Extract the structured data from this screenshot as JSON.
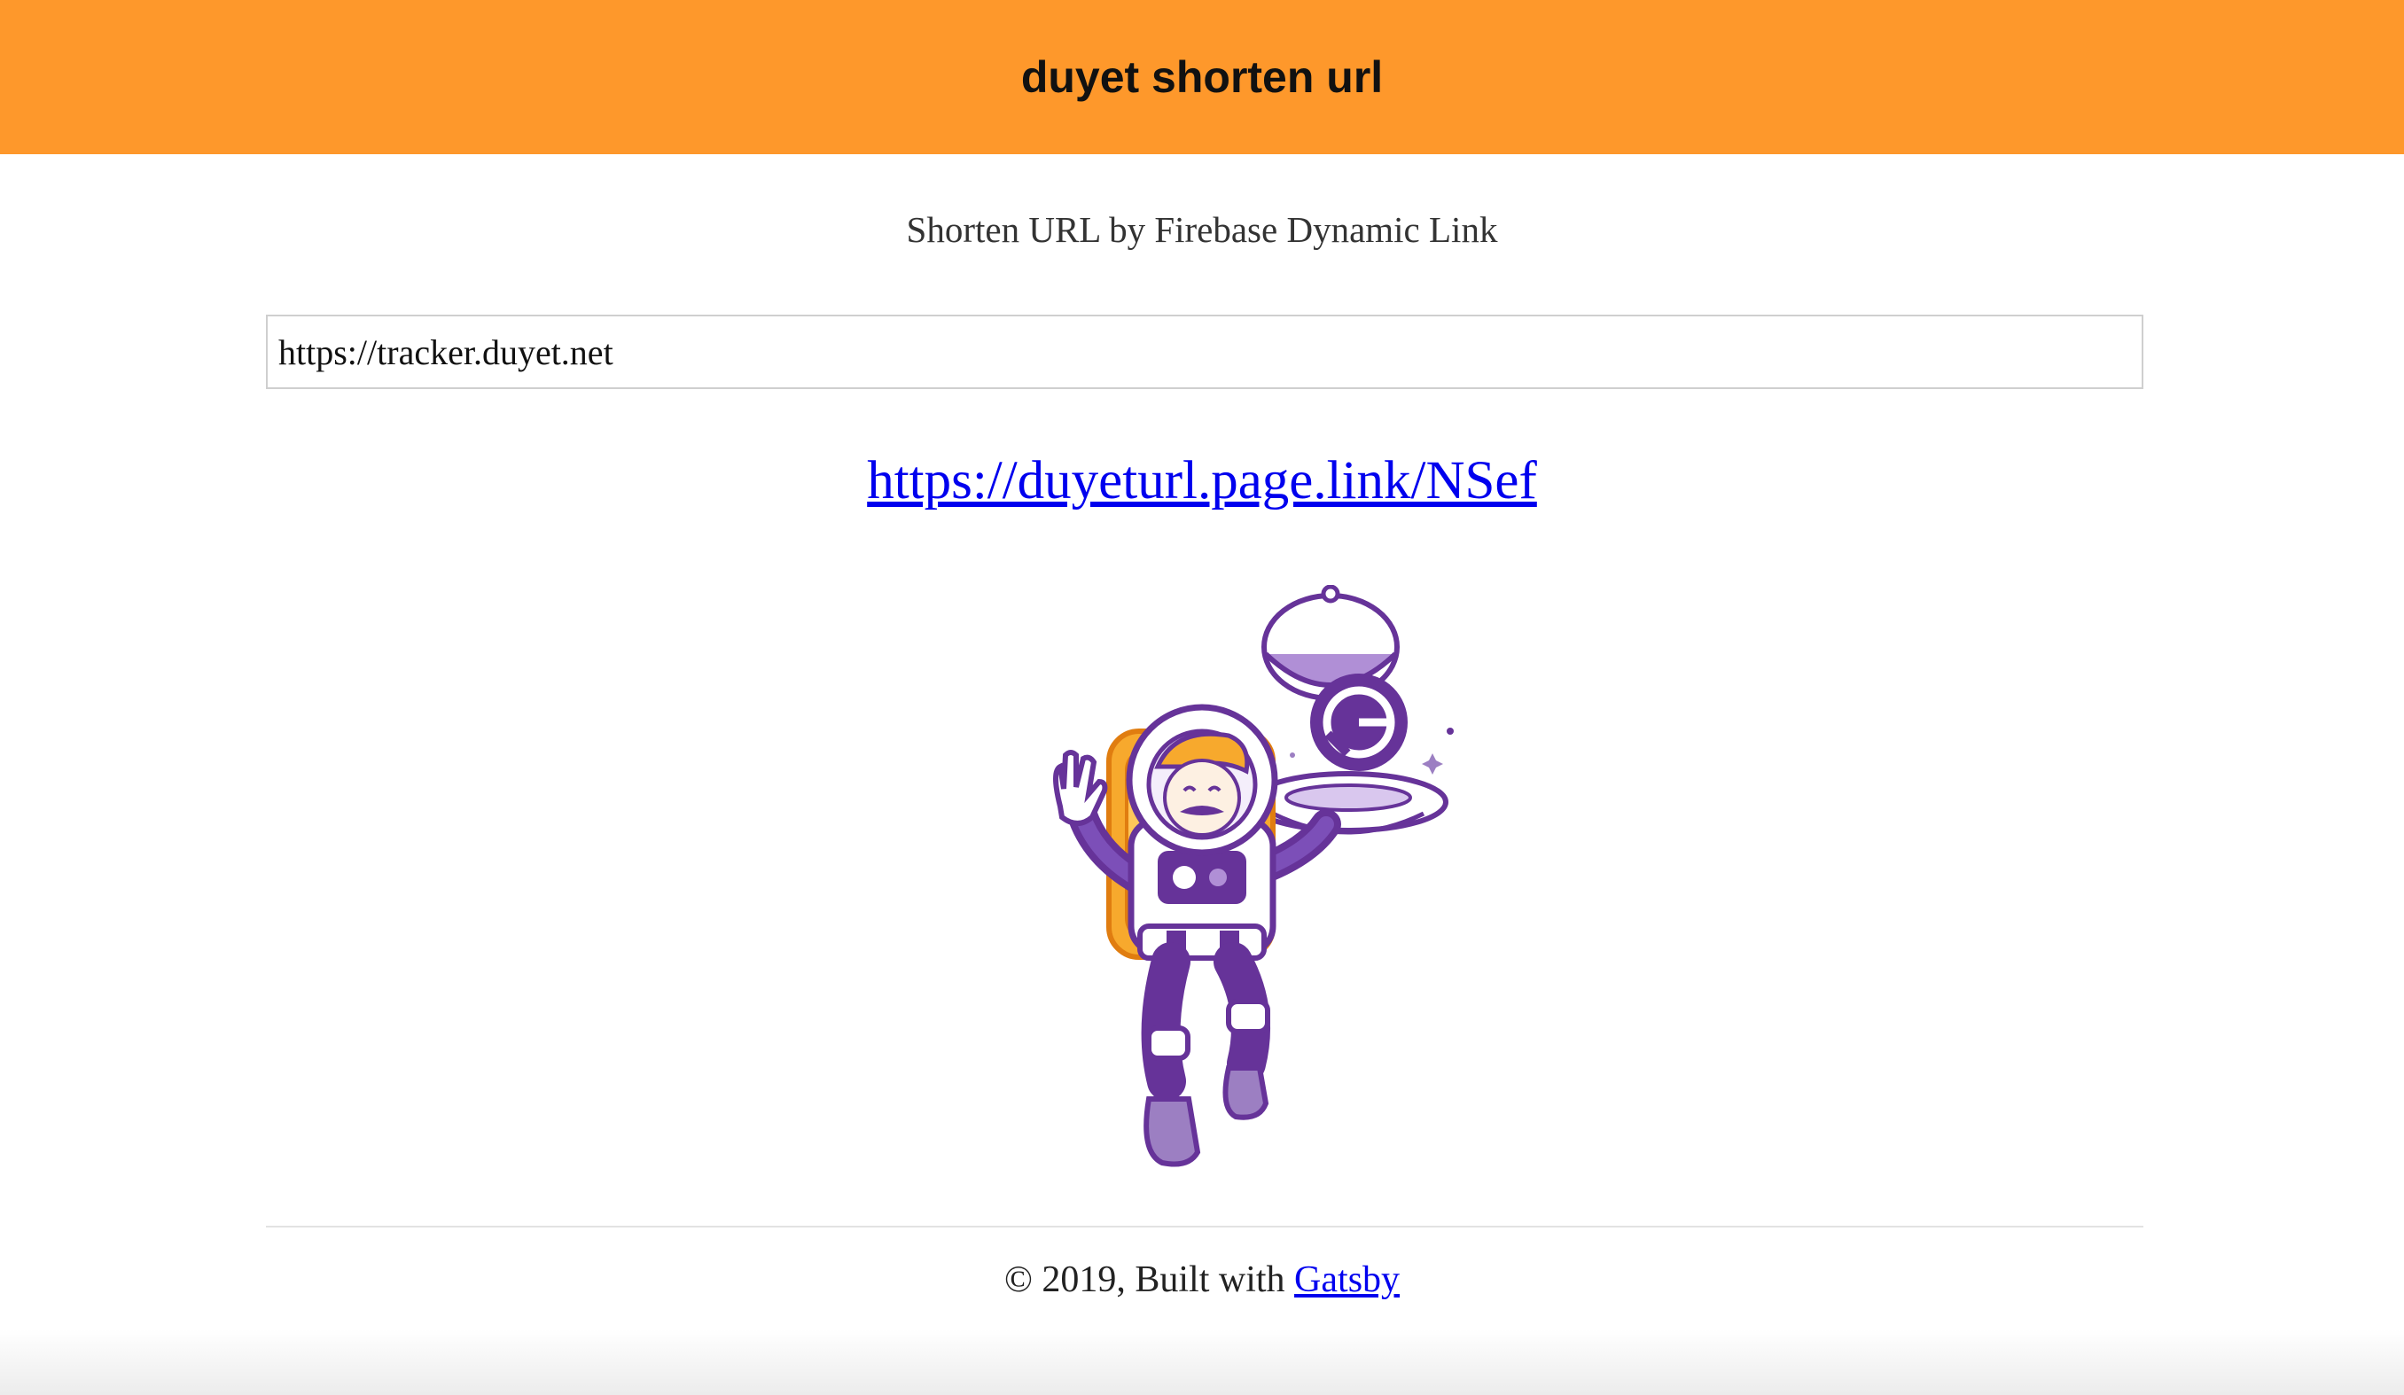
{
  "header": {
    "title": "duyet shorten url",
    "background_color": "#fe982b"
  },
  "main": {
    "subtitle": "Shorten URL by Firebase Dynamic Link",
    "url_input_value": "https://tracker.duyet.net",
    "short_link": "https://duyeturl.page.link/NSef",
    "illustration": "gatsby-astronaut-icon"
  },
  "footer": {
    "copyright_text": "© 2019, Built with",
    "gatsby_link": "Gatsby"
  },
  "colors": {
    "accent": "#fe982b",
    "link": "#0000ee",
    "astronaut_purple": "#663399"
  }
}
